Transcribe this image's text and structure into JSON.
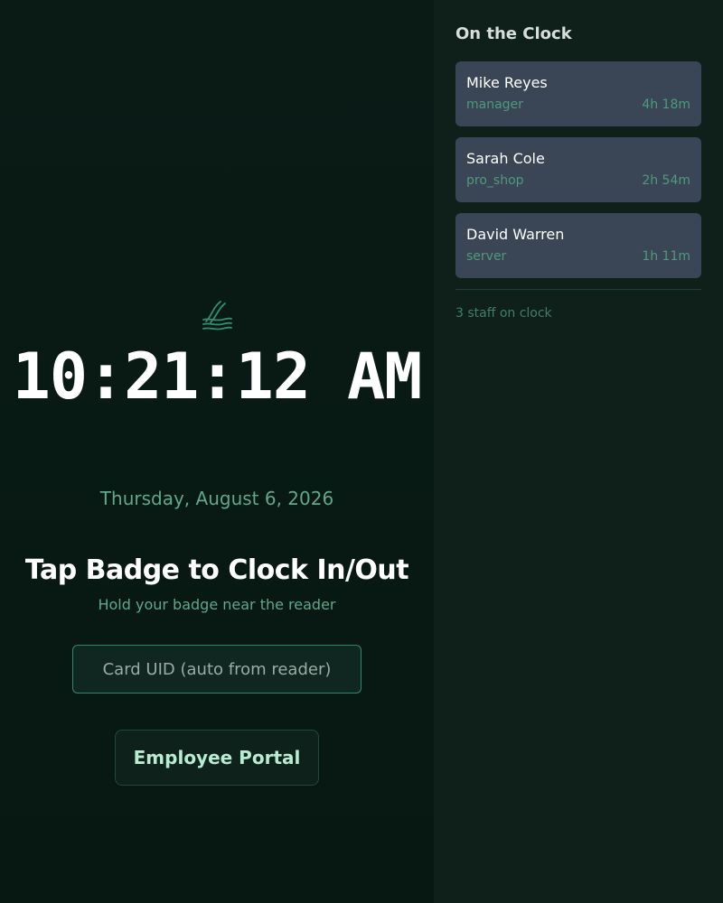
{
  "kiosk": {
    "logo_icon": "wave-logo-icon",
    "time": "10:21:12 AM",
    "date": "Thursday, August 6, 2026",
    "prompt_title": "Tap Badge to Clock In/Out",
    "prompt_subtitle": "Hold your badge near the reader",
    "card_uid": {
      "value": "",
      "placeholder": "Card UID (auto from reader)"
    },
    "portal_button_label": "Employee Portal"
  },
  "sidebar": {
    "title": "On the Clock",
    "staff": [
      {
        "name": "Mike Reyes",
        "role": "manager",
        "duration": "4h 18m"
      },
      {
        "name": "Sarah Cole",
        "role": "pro_shop",
        "duration": "2h 54m"
      },
      {
        "name": "David Warren",
        "role": "server",
        "duration": "1h 11m"
      }
    ],
    "footer": "3 staff on clock"
  },
  "colors": {
    "background": "#071812",
    "sidebar_bg": "#0f201b",
    "card_bg": "#3a4556",
    "accent_green": "#5fa88a",
    "input_border": "#2e8a66",
    "button_text": "#b8ecd2"
  }
}
